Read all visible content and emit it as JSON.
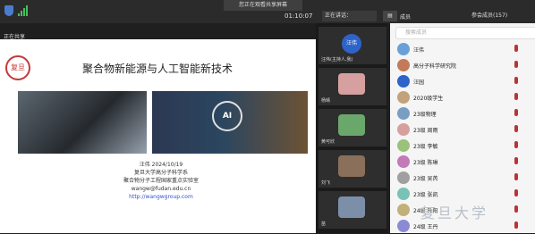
{
  "header": {
    "banner": "您正在观看共享屏幕",
    "timer": "01:10:07",
    "speaker_chip": "正在讲话：",
    "chip_mini": "▤",
    "members_label": "成员",
    "list_title": "参会成员(157)"
  },
  "presenter_label": "正在共享",
  "slide": {
    "logo_text": "复旦",
    "title": "聚合物新能源与人工智能新技术",
    "ai_text": "AI",
    "speaker": "汪伟 2024/10/19",
    "affiliation_1": "复旦大学高分子科学系",
    "affiliation_2": "聚合物分子工程国家重点实验室",
    "email": "wangw@fudan.edu.cn",
    "url": "http://wangwgroup.com"
  },
  "video_tiles": [
    {
      "label": "汪伟(主持人,我)",
      "avatar": "汪伟",
      "color": "#2e63c9"
    },
    {
      "label": "杨晴",
      "color": "#d6a0a0"
    },
    {
      "label": "黄可欣",
      "color": "#6aa76a"
    },
    {
      "label": "刘飞",
      "color": "#8a6f5a"
    },
    {
      "label": "苗",
      "color": "#7b8fa8"
    }
  ],
  "members": {
    "search_placeholder": "搜索成员",
    "items": [
      {
        "name": "汪伟",
        "color": "#6aa0d8"
      },
      {
        "name": "高分子科学研究院",
        "color": "#c27a5b"
      },
      {
        "name": "汪园",
        "color": "#2e63c9"
      },
      {
        "name": "2020级学生",
        "color": "#c2a27a"
      },
      {
        "name": "23级物理",
        "color": "#7a9ec2"
      },
      {
        "name": "23级 周雨",
        "color": "#d6a0a0"
      },
      {
        "name": "23级 李敏",
        "color": "#9ac27a"
      },
      {
        "name": "23级 陈琳",
        "color": "#c27ab8"
      },
      {
        "name": "23级 吴芮",
        "color": "#a0a0a0"
      },
      {
        "name": "23级 张凯",
        "color": "#7ac2b5"
      },
      {
        "name": "24级 孙阳",
        "color": "#c2b07a"
      },
      {
        "name": "24级 王丹",
        "color": "#8a8ad6"
      }
    ]
  },
  "watermark": "复旦大学"
}
